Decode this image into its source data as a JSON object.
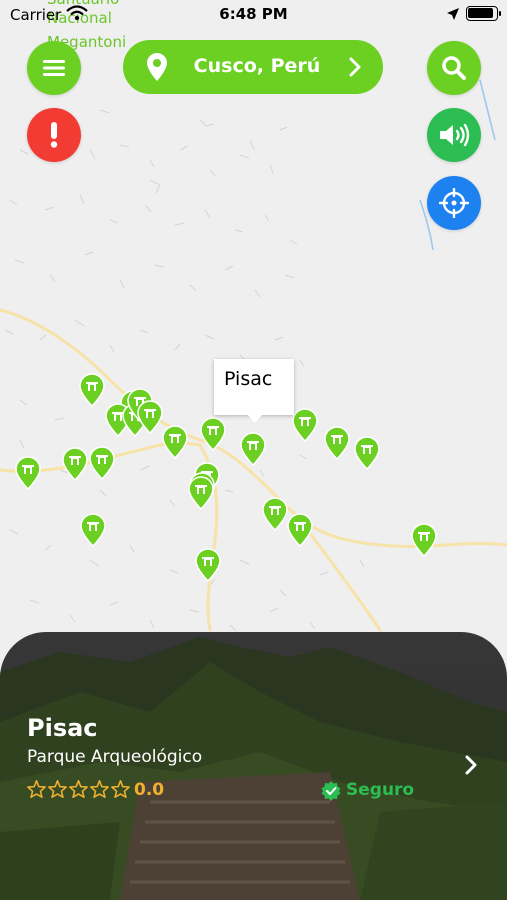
{
  "status_bar": {
    "carrier": "Carrier",
    "time": "6:48 PM"
  },
  "map": {
    "place_labels": [
      "Santuario",
      "Nacional",
      "Megantoni"
    ],
    "callout": "Pisac",
    "marker_color": "#6bd021",
    "marker_count": 23
  },
  "header": {
    "city": "Cusco, Perú",
    "menu_icon": "menu-icon",
    "search_icon": "search-icon",
    "alert_icon": "exclamation-icon",
    "sound_icon": "speaker-icon",
    "locate_icon": "crosshair-icon"
  },
  "card": {
    "title": "Pisac",
    "subtitle": "Parque Arqueológico",
    "rating": "0.0",
    "stars_filled": 0,
    "safe_label": "Seguro",
    "safe_color": "#2cbe52",
    "rating_color": "#f1b12f"
  },
  "colors": {
    "primary_green": "#6bd021",
    "alert_red": "#f23b32",
    "sound_green": "#2cbe52",
    "locate_blue": "#1d82f0"
  }
}
